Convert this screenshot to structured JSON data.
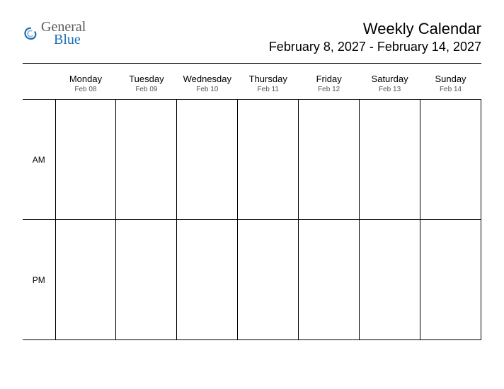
{
  "logo": {
    "general": "General",
    "blue": "Blue"
  },
  "header": {
    "title": "Weekly Calendar",
    "daterange": "February 8, 2027 - February 14, 2027"
  },
  "days": [
    {
      "name": "Monday",
      "date": "Feb 08"
    },
    {
      "name": "Tuesday",
      "date": "Feb 09"
    },
    {
      "name": "Wednesday",
      "date": "Feb 10"
    },
    {
      "name": "Thursday",
      "date": "Feb 11"
    },
    {
      "name": "Friday",
      "date": "Feb 12"
    },
    {
      "name": "Saturday",
      "date": "Feb 13"
    },
    {
      "name": "Sunday",
      "date": "Feb 14"
    }
  ],
  "slots": {
    "am": "AM",
    "pm": "PM"
  }
}
